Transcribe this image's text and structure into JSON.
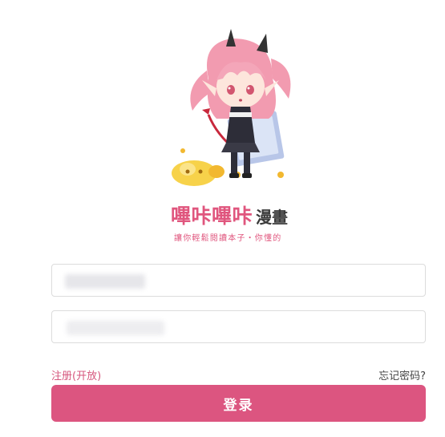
{
  "logo": {
    "title_pink": "嗶咔嗶咔",
    "title_dark": "漫畫",
    "tagline": "讓你輕鬆閱讀本子・你懂的"
  },
  "form": {
    "username_value": "",
    "password_value": ""
  },
  "links": {
    "register": "注册(开放)",
    "forgot": "忘记密码?"
  },
  "login_button": "登录",
  "colors": {
    "accent": "#dc5580",
    "link_pink": "#d6567d"
  }
}
